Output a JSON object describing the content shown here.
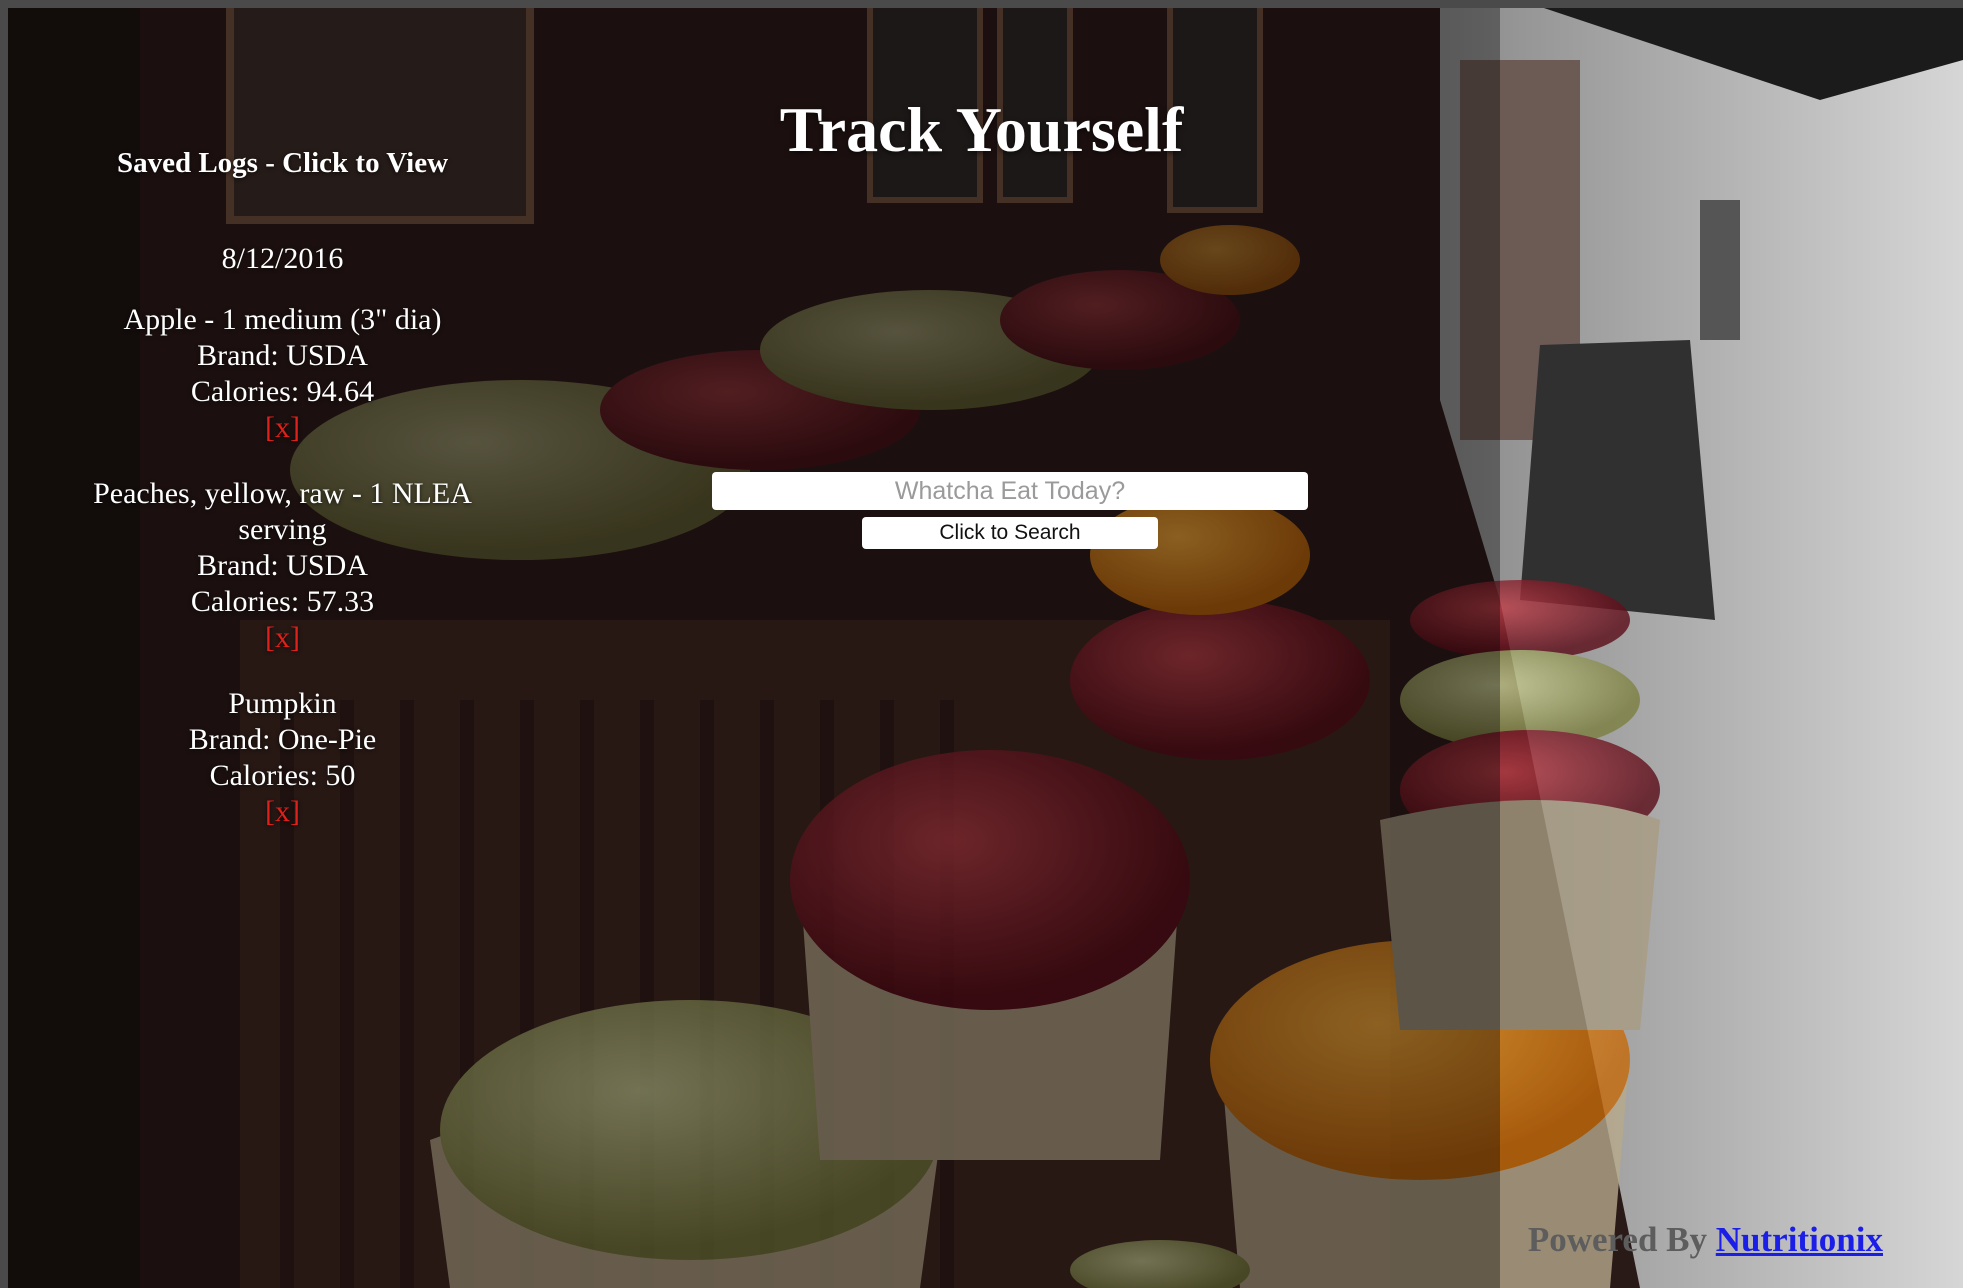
{
  "header": {
    "title": "Track Yourself"
  },
  "sidebar": {
    "heading": "Saved Logs - Click to View",
    "date": "8/12/2016",
    "entries": [
      {
        "name": "Apple - 1 medium (3\" dia)",
        "brand": "Brand: USDA",
        "calories": "Calories: 94.64",
        "remove": "[x]"
      },
      {
        "name": "Peaches, yellow, raw - 1 NLEA serving",
        "brand": "Brand: USDA",
        "calories": "Calories: 57.33",
        "remove": "[x]"
      },
      {
        "name": "Pumpkin",
        "brand": "Brand: One-Pie",
        "calories": "Calories: 50",
        "remove": "[x]"
      }
    ]
  },
  "search": {
    "placeholder": "Whatcha Eat Today?",
    "button_label": "Click to Search"
  },
  "footer": {
    "label": "Powered By",
    "link": "Nutritionix"
  },
  "colors": {
    "remove": "#e0201a",
    "link": "#1a1ee6",
    "footer_label": "#5d5d5d",
    "title": "#ffffff"
  }
}
